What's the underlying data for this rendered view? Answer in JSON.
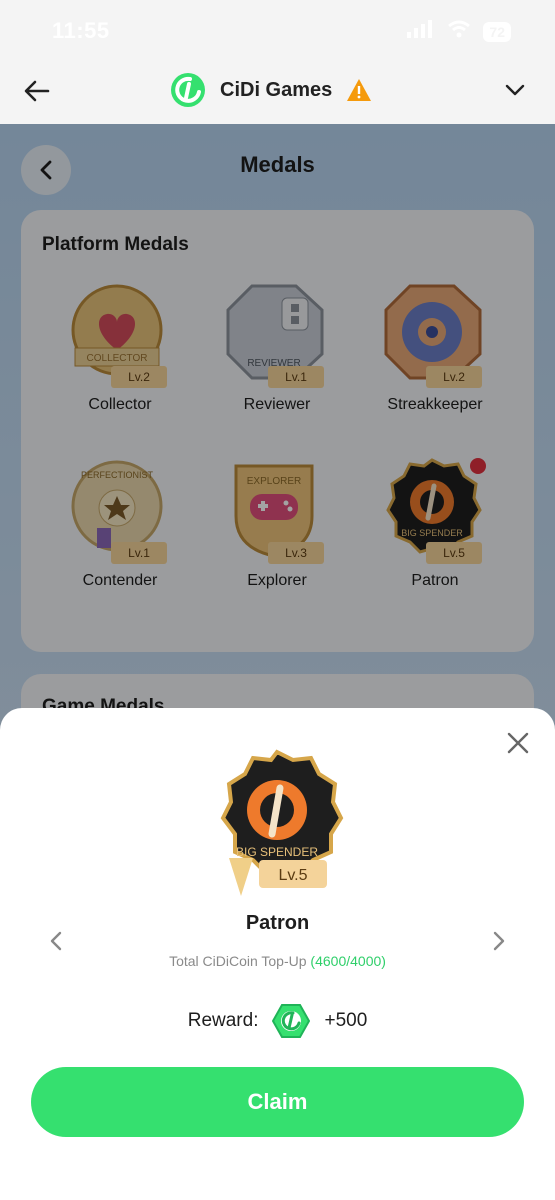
{
  "status_bar": {
    "time": "11:55",
    "battery": "72"
  },
  "header": {
    "title": "CiDi Games"
  },
  "page": {
    "title": "Medals",
    "platform_section": "Platform Medals",
    "game_section": "Game Medals",
    "medals": [
      {
        "name": "Collector",
        "level": "Lv.2",
        "ribbon": "COLLECTOR"
      },
      {
        "name": "Reviewer",
        "level": "Lv.1",
        "ribbon": "REVIEWER"
      },
      {
        "name": "Streakkeeper",
        "level": "Lv.2",
        "ribbon": ""
      },
      {
        "name": "Contender",
        "level": "Lv.1",
        "ribbon": "PERFECTIONIST"
      },
      {
        "name": "Explorer",
        "level": "Lv.3",
        "ribbon": "EXPLORER"
      },
      {
        "name": "Patron",
        "level": "Lv.5",
        "ribbon": "BIG SPENDER"
      }
    ]
  },
  "sheet": {
    "medal_name": "Patron",
    "medal_level": "Lv.5",
    "medal_ribbon": "BIG SPENDER",
    "description": "Total CiDiCoin Top-Up",
    "progress": "(4600/4000)",
    "reward_label": "Reward:",
    "reward_value": "+500",
    "claim_label": "Claim"
  },
  "colors": {
    "accent": "#35e06f",
    "progress": "#2fcf6a",
    "warning": "#f59a0c"
  }
}
